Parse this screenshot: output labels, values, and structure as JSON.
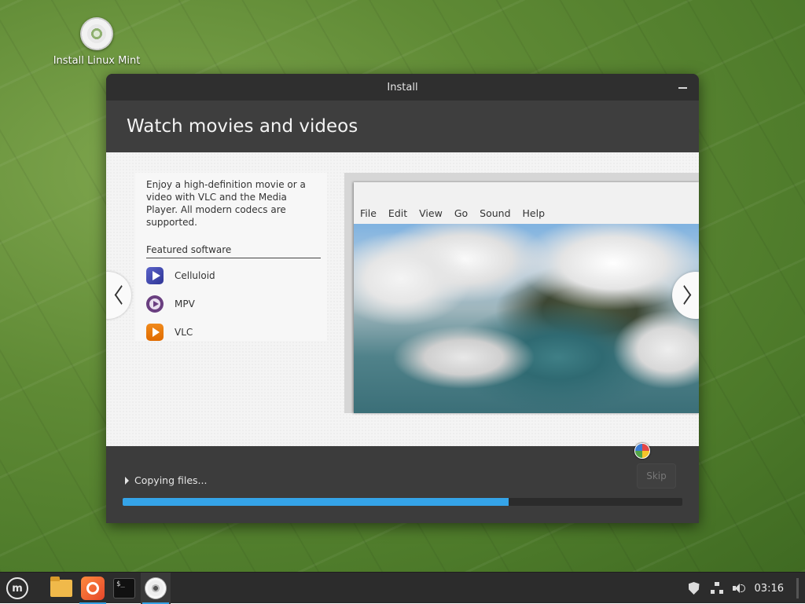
{
  "desktop": {
    "icon_label": "Install Linux Mint"
  },
  "window": {
    "title": "Install",
    "header_title": "Watch movies and videos"
  },
  "slide": {
    "description": "Enjoy a high-definition movie or a video with VLC and the Media Player. All modern codecs are supported.",
    "featured_label": "Featured software",
    "apps": [
      {
        "name": "Celluloid",
        "icon": "celluloid-icon"
      },
      {
        "name": "MPV",
        "icon": "mpv-icon"
      },
      {
        "name": "VLC",
        "icon": "vlc-icon"
      }
    ],
    "player_menu": [
      "File",
      "Edit",
      "View",
      "Go",
      "Sound",
      "Help"
    ]
  },
  "footer": {
    "status": "Copying files...",
    "skip_label": "Skip",
    "progress": 0.69
  },
  "taskbar": {
    "apps": [
      "menu-icon",
      "files-icon",
      "firefox-icon",
      "terminal-icon",
      "installer-disc-icon"
    ],
    "terminal_glyph": "$_",
    "clock": "03:16",
    "mint_glyph": "m"
  },
  "colors": {
    "accent": "#35a4e8",
    "window_bg": "#3c3c3c",
    "titlebar_bg": "#2f2f2f"
  }
}
